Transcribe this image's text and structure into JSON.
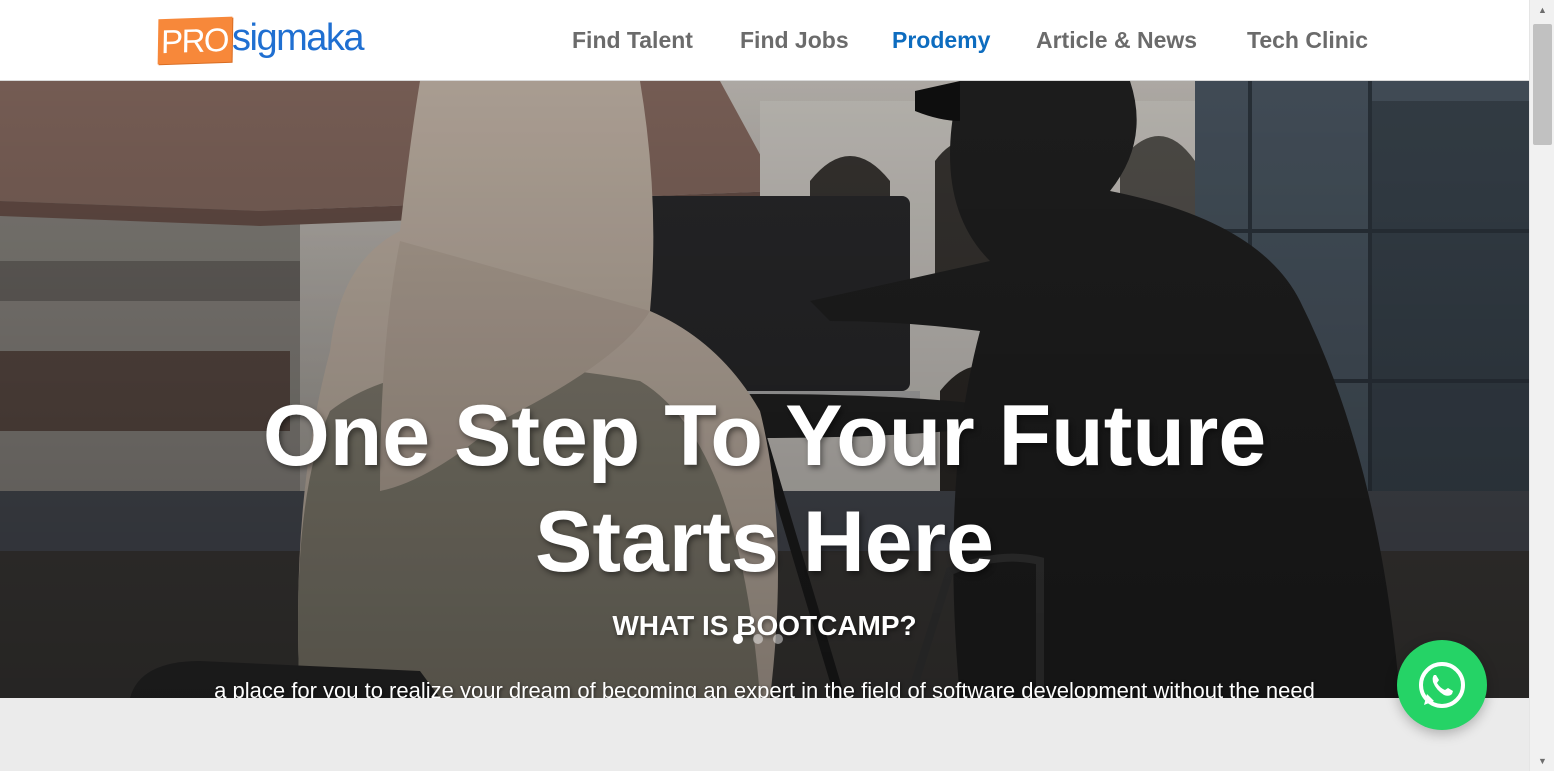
{
  "header": {
    "logo": {
      "part1": "PRO",
      "part2": "sigmaka"
    },
    "nav": [
      {
        "label": "Find Talent",
        "active": false
      },
      {
        "label": "Find Jobs",
        "active": false
      },
      {
        "label": "Prodemy",
        "active": true
      },
      {
        "label": "Article & News",
        "active": false
      },
      {
        "label": "Tech Clinic",
        "active": false
      }
    ]
  },
  "hero": {
    "title_line1": "One Step To Your Future",
    "title_line2": "Starts Here",
    "subtitle": "WHAT IS BOOTCAMP?",
    "description": "a place for you to realize your dream of becoming an expert in the field of software development without the need for basic skills or a computer background and here you will be trained until you can and work right away.",
    "carousel": {
      "slide_count": 3,
      "active_index": 0
    }
  },
  "colors": {
    "brand_orange": "#f7883a",
    "brand_blue": "#1f6fd1",
    "nav_active": "#0d6cbf",
    "nav_text": "#6b6b6b",
    "whatsapp_green": "#25d366"
  },
  "icons": {
    "whatsapp": "whatsapp-icon",
    "scroll_up": "arrow-up-icon",
    "scroll_down": "arrow-down-icon"
  }
}
